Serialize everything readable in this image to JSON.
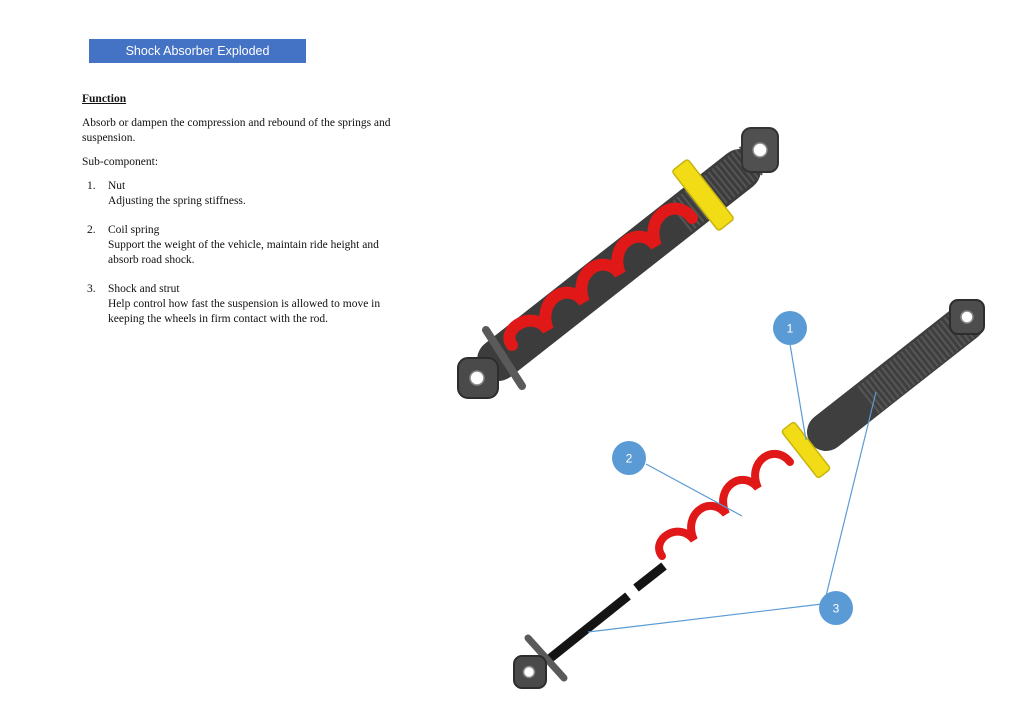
{
  "page": {
    "title": "Shock Absorber  Exploded"
  },
  "function_section": {
    "heading": "Function",
    "description": "Absorb or dampen the compression and rebound of the springs and suspension.",
    "subcomponent_label": "Sub-component:",
    "items": [
      {
        "number": "1.",
        "name": "Nut",
        "description": "Adjusting the spring stiffness."
      },
      {
        "number": "2.",
        "name": "Coil spring",
        "description": "Support the weight of the vehicle, maintain ride height and absorb road shock."
      },
      {
        "number": "3.",
        "name": "Shock and strut",
        "description": "Help control how fast the suspension is allowed to move in keeping the wheels in firm contact with the rod."
      }
    ]
  },
  "callouts": [
    {
      "label": "1"
    },
    {
      "label": "2"
    },
    {
      "label": "3"
    }
  ],
  "colors": {
    "title_bar": "#4472c4",
    "callout": "#5b9bd5",
    "spring": "#e01818",
    "nut": "#f2dc16",
    "body": "#3c3c3c",
    "rod": "#141414"
  }
}
